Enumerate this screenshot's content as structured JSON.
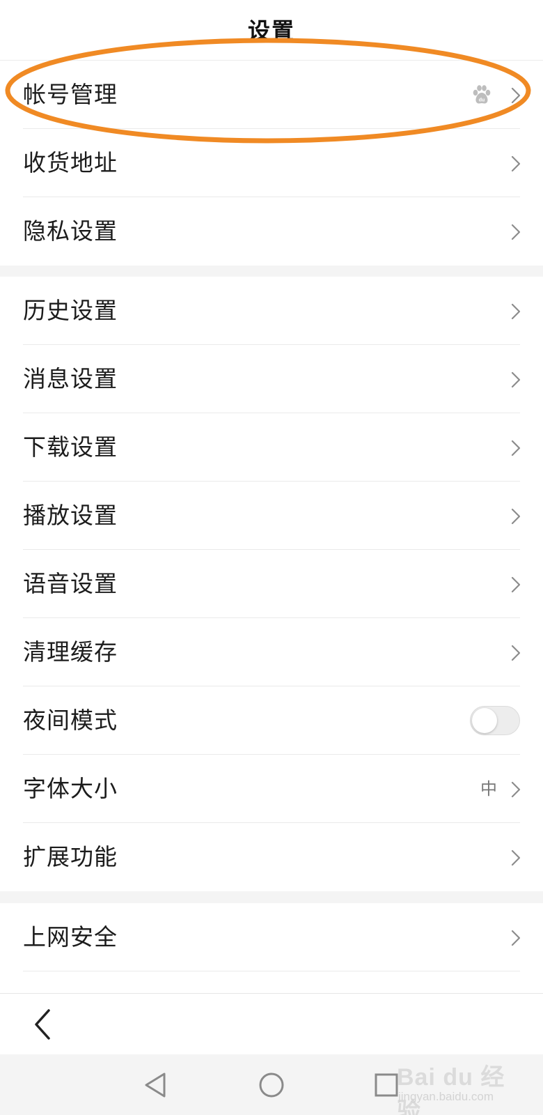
{
  "header": {
    "title": "设置"
  },
  "section1": {
    "items": [
      {
        "label": "帐号管理",
        "trailing_icon": "baidu-paw-icon"
      },
      {
        "label": "收货地址"
      },
      {
        "label": "隐私设置"
      }
    ]
  },
  "section2": {
    "items": [
      {
        "label": "历史设置"
      },
      {
        "label": "消息设置"
      },
      {
        "label": "下载设置"
      },
      {
        "label": "播放设置"
      },
      {
        "label": "语音设置"
      },
      {
        "label": "清理缓存"
      },
      {
        "label": "夜间模式",
        "toggle": false
      },
      {
        "label": "字体大小",
        "value": "中"
      },
      {
        "label": "扩展功能"
      }
    ]
  },
  "section3": {
    "items": [
      {
        "label": "上网安全"
      }
    ]
  },
  "bottom_bar": {
    "back_icon": "chevron-left-icon"
  },
  "navbar": {
    "icons": [
      "nav-back-triangle-icon",
      "nav-home-circle-icon",
      "nav-recents-square-icon"
    ]
  },
  "watermark": {
    "main": "Bai du 经验",
    "sub": "jingyan.baidu.com"
  },
  "colors": {
    "highlight": "#f08a24",
    "background": "#f4f4f4",
    "surface": "#ffffff",
    "chevron": "#8c8c8c"
  }
}
